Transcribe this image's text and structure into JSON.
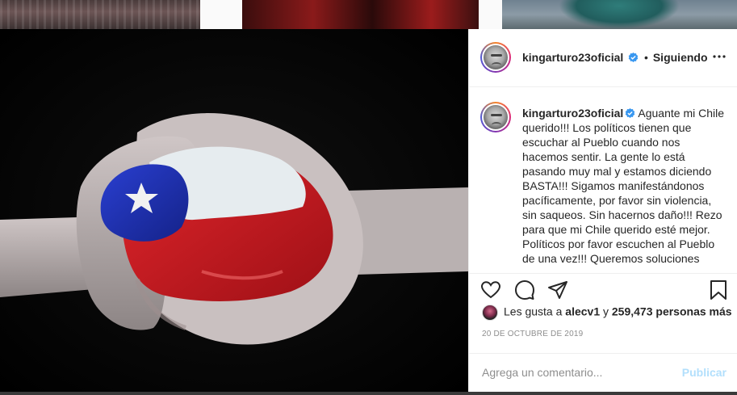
{
  "post": {
    "username": "kingarturo23oficial",
    "separator": "•",
    "follow_status": "Siguiendo",
    "caption_text": "Aguante mi Chile querido!!! Los políticos tienen que escuchar al Pueblo cuando nos hacemos sentir. La gente lo está pasando muy mal y estamos diciendo BASTA!!! Sigamos manifestándonos pacíficamente, por favor sin violencia, sin saqueos. Sin hacernos daño!!! Rezo para que mi Chile querido esté mejor. Políticos por favor escuchen al Pueblo de una vez!!! Queremos soluciones",
    "likes_prefix": "Les gusta a ",
    "likes_user": "alecv1",
    "likes_middle": " y ",
    "likes_count": "259,473 personas más",
    "date": "20 DE OCTUBRE DE 2019"
  },
  "comment_box": {
    "placeholder": "Agrega un comentario...",
    "publish_label": "Publicar"
  },
  "icons": {
    "like": "heart-icon",
    "comment": "comment-icon",
    "share": "share-icon",
    "save": "bookmark-icon",
    "more": "more-options-icon",
    "verified": "verified-badge-icon"
  },
  "colors": {
    "verified_blue": "#3897f0",
    "publish_disabled": "#b2dffc",
    "muted_text": "#8e8e8e"
  }
}
